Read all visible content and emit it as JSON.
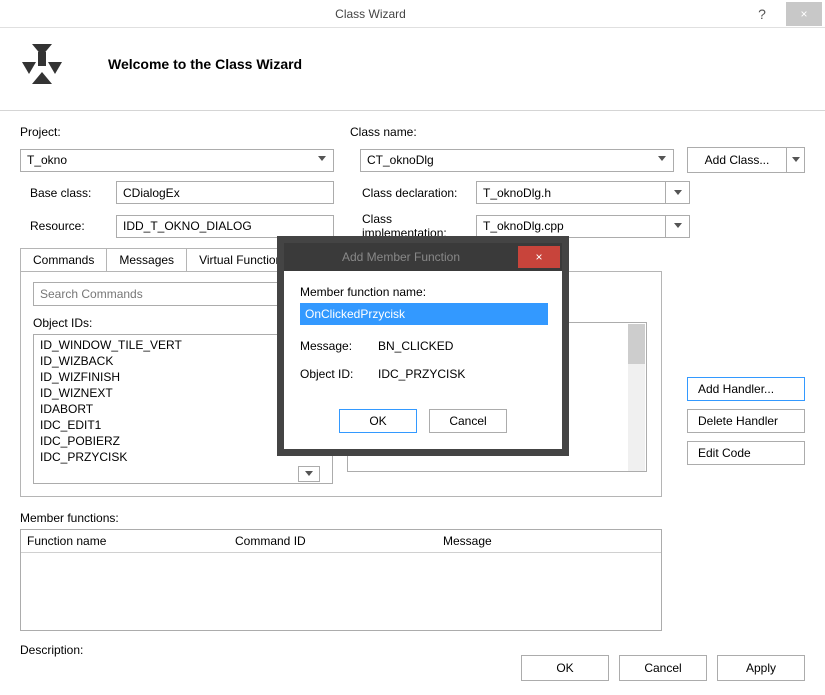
{
  "titlebar": {
    "title": "Class Wizard",
    "help": "?",
    "close": "×"
  },
  "header": {
    "welcome": "Welcome to the Class Wizard"
  },
  "labels": {
    "project": "Project:",
    "classname": "Class name:",
    "baseclass": "Base class:",
    "resource": "Resource:",
    "classdecl": "Class declaration:",
    "classimpl": "Class implementation:",
    "objectids": "Object IDs:",
    "memberfunc": "Member functions:",
    "description": "Description:"
  },
  "combos": {
    "project": "T_okno",
    "classname": "CT_oknoDlg",
    "baseclass": "CDialogEx",
    "resource": "IDD_T_OKNO_DIALOG",
    "classdecl": "T_oknoDlg.h",
    "classimpl": "T_oknoDlg.cpp"
  },
  "buttons": {
    "addclass": "Add Class...",
    "addhandler": "Add Handler...",
    "deletehandler": "Delete Handler",
    "editcode": "Edit Code",
    "ok": "OK",
    "cancel": "Cancel",
    "apply": "Apply"
  },
  "tabs": [
    "Commands",
    "Messages",
    "Virtual Functions"
  ],
  "search": {
    "placeholder": "Search Commands"
  },
  "objectIds": [
    "ID_WINDOW_TILE_VERT",
    "ID_WIZBACK",
    "ID_WIZFINISH",
    "ID_WIZNEXT",
    "IDABORT",
    "IDC_EDIT1",
    "IDC_POBIERZ",
    "IDC_PRZYCISK"
  ],
  "grid": {
    "col1": "Function name",
    "col2": "Command ID",
    "col3": "Message"
  },
  "modal": {
    "title": "Add Member Function",
    "label_name": "Member function name:",
    "value_name": "OnClickedPrzycisk",
    "label_message": "Message:",
    "value_message": "BN_CLICKED",
    "label_objectid": "Object ID:",
    "value_objectid": "IDC_PRZYCISK",
    "ok": "OK",
    "cancel": "Cancel",
    "close": "×"
  }
}
